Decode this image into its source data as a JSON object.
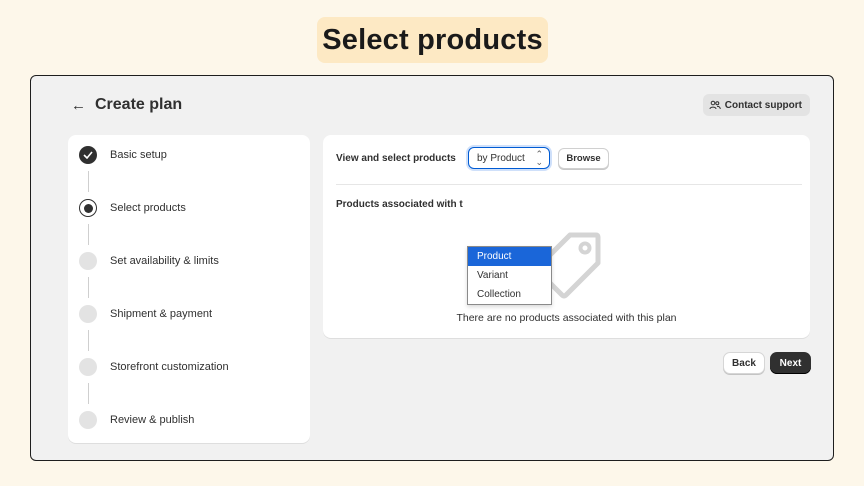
{
  "headline": "Select products",
  "header": {
    "back_icon": "arrow-left-icon",
    "title": "Create plan",
    "contact_support_label": "Contact support",
    "contact_icon": "people-icon"
  },
  "steps": [
    {
      "label": "Basic setup",
      "state": "done"
    },
    {
      "label": "Select products",
      "state": "current"
    },
    {
      "label": "Set availability & limits",
      "state": "pending"
    },
    {
      "label": "Shipment & payment",
      "state": "pending"
    },
    {
      "label": "Storefront customization",
      "state": "pending"
    },
    {
      "label": "Review & publish",
      "state": "pending"
    }
  ],
  "products": {
    "view_label": "View and select products",
    "select_value": "by Product",
    "browse_label": "Browse",
    "associated_heading": "Products associated with t",
    "empty_icon": "tag-icon",
    "empty_text": "There are no products associated with this plan"
  },
  "dropdown": {
    "options": [
      "Product",
      "Variant",
      "Collection"
    ],
    "selected": "Product"
  },
  "footer": {
    "back_label": "Back",
    "next_label": "Next"
  },
  "colors": {
    "page_bg": "#fdf7ea",
    "headline_bg": "#fde9c4",
    "frame_bg": "#f1f1f1",
    "primary": "#303030",
    "focus_blue": "#005bd3",
    "dropdown_highlight": "#1a66d9"
  }
}
